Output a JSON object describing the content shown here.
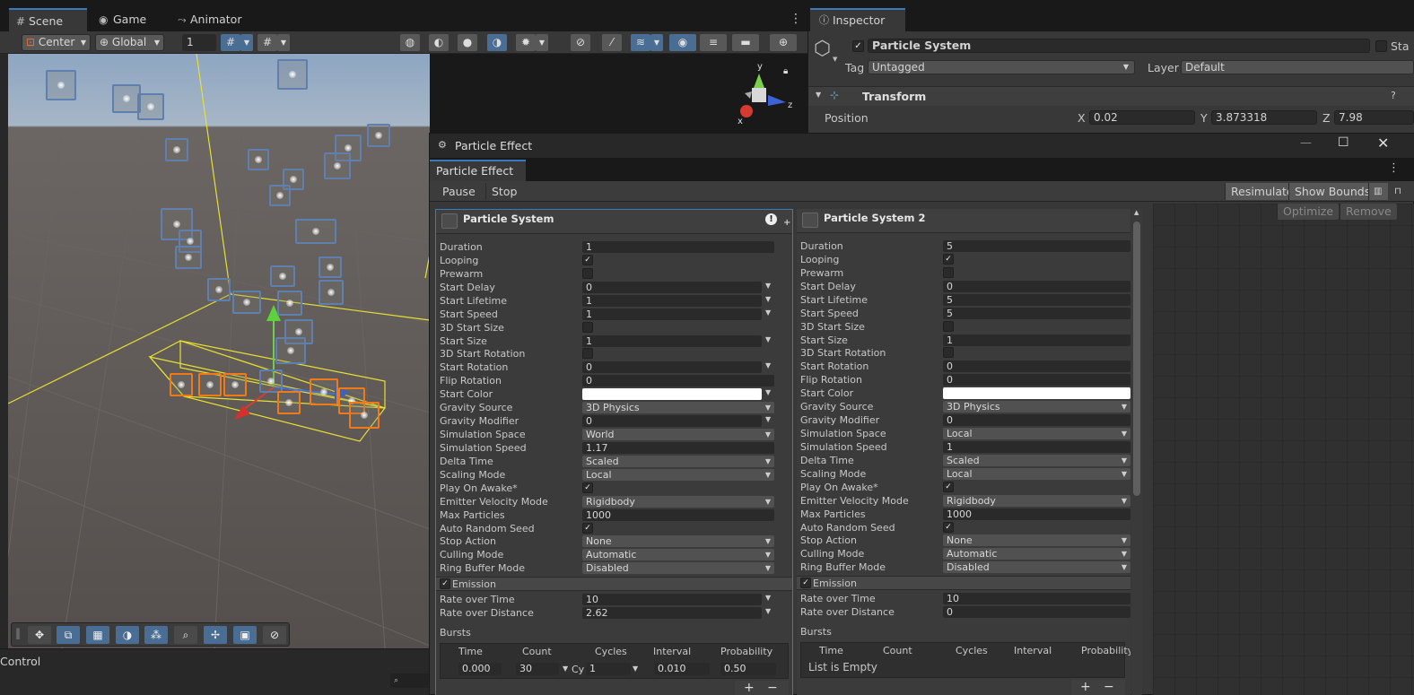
{
  "scene_tabs": [
    {
      "label": "Scene",
      "icon": "grid-icon"
    },
    {
      "label": "Game",
      "icon": "gamepad-icon"
    },
    {
      "label": "Animator",
      "icon": "animator-icon"
    }
  ],
  "scene_toolbar": {
    "pivot_mode": "Center",
    "space_mode": "Global",
    "grid_snap_value": "1"
  },
  "control_label": "Control",
  "inspector": {
    "tab_label": "Inspector",
    "object_name": "Particle System",
    "static_label": "Sta",
    "tag_label": "Tag",
    "tag_value": "Untagged",
    "layer_label": "Layer",
    "layer_value": "Default",
    "transform_label": "Transform",
    "position_label": "Position",
    "x_label": "X",
    "x_value": "0.02",
    "y_label": "Y",
    "y_value": "3.873318",
    "z_label": "Z",
    "z_value": "7.98"
  },
  "particle_window": {
    "title": "Particle Effect",
    "tab_label": "Particle Effect",
    "pause_label": "Pause",
    "stop_label": "Stop",
    "resimulate_label": "Resimulate",
    "show_bounds_label": "Show Bounds",
    "optimize_label": "Optimize",
    "remove_label": "Remove"
  },
  "systems": [
    {
      "name": "Particle System",
      "rows": [
        {
          "label": "Duration",
          "type": "num",
          "value": "1"
        },
        {
          "label": "Looping",
          "type": "check",
          "value": "✓"
        },
        {
          "label": "Prewarm",
          "type": "check",
          "value": ""
        },
        {
          "label": "Start Delay",
          "type": "num",
          "value": "0",
          "menu": true
        },
        {
          "label": "Start Lifetime",
          "type": "num",
          "value": "1",
          "menu": true
        },
        {
          "label": "Start Speed",
          "type": "num",
          "value": "1",
          "menu": true
        },
        {
          "label": "3D Start Size",
          "type": "check",
          "value": ""
        },
        {
          "label": "Start Size",
          "type": "num",
          "value": "1",
          "menu": true
        },
        {
          "label": "3D Start Rotation",
          "type": "check",
          "value": ""
        },
        {
          "label": "Start Rotation",
          "type": "num",
          "value": "0",
          "menu": true
        },
        {
          "label": "Flip Rotation",
          "type": "num",
          "value": "0"
        },
        {
          "label": "Start Color",
          "type": "color",
          "value": "#ffffff",
          "menu": true
        },
        {
          "label": "Gravity Source",
          "type": "dd",
          "value": "3D Physics"
        },
        {
          "label": "Gravity Modifier",
          "type": "num",
          "value": "0",
          "menu": true
        },
        {
          "label": "Simulation Space",
          "type": "dd",
          "value": "World"
        },
        {
          "label": "Simulation Speed",
          "type": "num",
          "value": "1.17"
        },
        {
          "label": "Delta Time",
          "type": "dd",
          "value": "Scaled"
        },
        {
          "label": "Scaling Mode",
          "type": "dd",
          "value": "Local"
        },
        {
          "label": "Play On Awake*",
          "type": "check",
          "value": "✓"
        },
        {
          "label": "Emitter Velocity Mode",
          "type": "dd",
          "value": "Rigidbody"
        },
        {
          "label": "Max Particles",
          "type": "num",
          "value": "1000"
        },
        {
          "label": "Auto Random Seed",
          "type": "check",
          "value": "✓"
        },
        {
          "label": "Stop Action",
          "type": "dd",
          "value": "None"
        },
        {
          "label": "Culling Mode",
          "type": "dd",
          "value": "Automatic"
        },
        {
          "label": "Ring Buffer Mode",
          "type": "dd",
          "value": "Disabled"
        }
      ],
      "emission_label": "Emission",
      "rate_over_time_label": "Rate over Time",
      "rate_over_time": "10",
      "rate_over_distance_label": "Rate over Distance",
      "rate_over_distance": "2.62",
      "bursts_label": "Bursts",
      "burst_headers": [
        "Time",
        "Count",
        "Cycles",
        "Interval",
        "Probability"
      ],
      "burst": {
        "time": "0.000",
        "count": "30",
        "cycles_prefix": "Cy",
        "cycles": "1",
        "interval": "0.010",
        "probability": "0.50"
      }
    },
    {
      "name": "Particle System 2",
      "rows": [
        {
          "label": "Duration",
          "type": "num",
          "value": "5"
        },
        {
          "label": "Looping",
          "type": "check",
          "value": "✓"
        },
        {
          "label": "Prewarm",
          "type": "check",
          "value": ""
        },
        {
          "label": "Start Delay",
          "type": "num",
          "value": "0"
        },
        {
          "label": "Start Lifetime",
          "type": "num",
          "value": "5"
        },
        {
          "label": "Start Speed",
          "type": "num",
          "value": "5"
        },
        {
          "label": "3D Start Size",
          "type": "check",
          "value": ""
        },
        {
          "label": "Start Size",
          "type": "num",
          "value": "1"
        },
        {
          "label": "3D Start Rotation",
          "type": "check",
          "value": ""
        },
        {
          "label": "Start Rotation",
          "type": "num",
          "value": "0"
        },
        {
          "label": "Flip Rotation",
          "type": "num",
          "value": "0"
        },
        {
          "label": "Start Color",
          "type": "color",
          "value": "#ffffff"
        },
        {
          "label": "Gravity Source",
          "type": "dd",
          "value": "3D Physics"
        },
        {
          "label": "Gravity Modifier",
          "type": "num",
          "value": "0"
        },
        {
          "label": "Simulation Space",
          "type": "dd",
          "value": "Local"
        },
        {
          "label": "Simulation Speed",
          "type": "num",
          "value": "1"
        },
        {
          "label": "Delta Time",
          "type": "dd",
          "value": "Scaled"
        },
        {
          "label": "Scaling Mode",
          "type": "dd",
          "value": "Local"
        },
        {
          "label": "Play On Awake*",
          "type": "check",
          "value": "✓"
        },
        {
          "label": "Emitter Velocity Mode",
          "type": "dd",
          "value": "Rigidbody"
        },
        {
          "label": "Max Particles",
          "type": "num",
          "value": "1000"
        },
        {
          "label": "Auto Random Seed",
          "type": "check",
          "value": "✓"
        },
        {
          "label": "Stop Action",
          "type": "dd",
          "value": "None"
        },
        {
          "label": "Culling Mode",
          "type": "dd",
          "value": "Automatic"
        },
        {
          "label": "Ring Buffer Mode",
          "type": "dd",
          "value": "Disabled"
        }
      ],
      "emission_label": "Emission",
      "rate_over_time_label": "Rate over Time",
      "rate_over_time": "10",
      "rate_over_distance_label": "Rate over Distance",
      "rate_over_distance": "0",
      "bursts_label": "Bursts",
      "burst_headers": [
        "Time",
        "Count",
        "Cycles",
        "Interval",
        "Probability"
      ],
      "empty_list_label": "List is Empty"
    }
  ]
}
